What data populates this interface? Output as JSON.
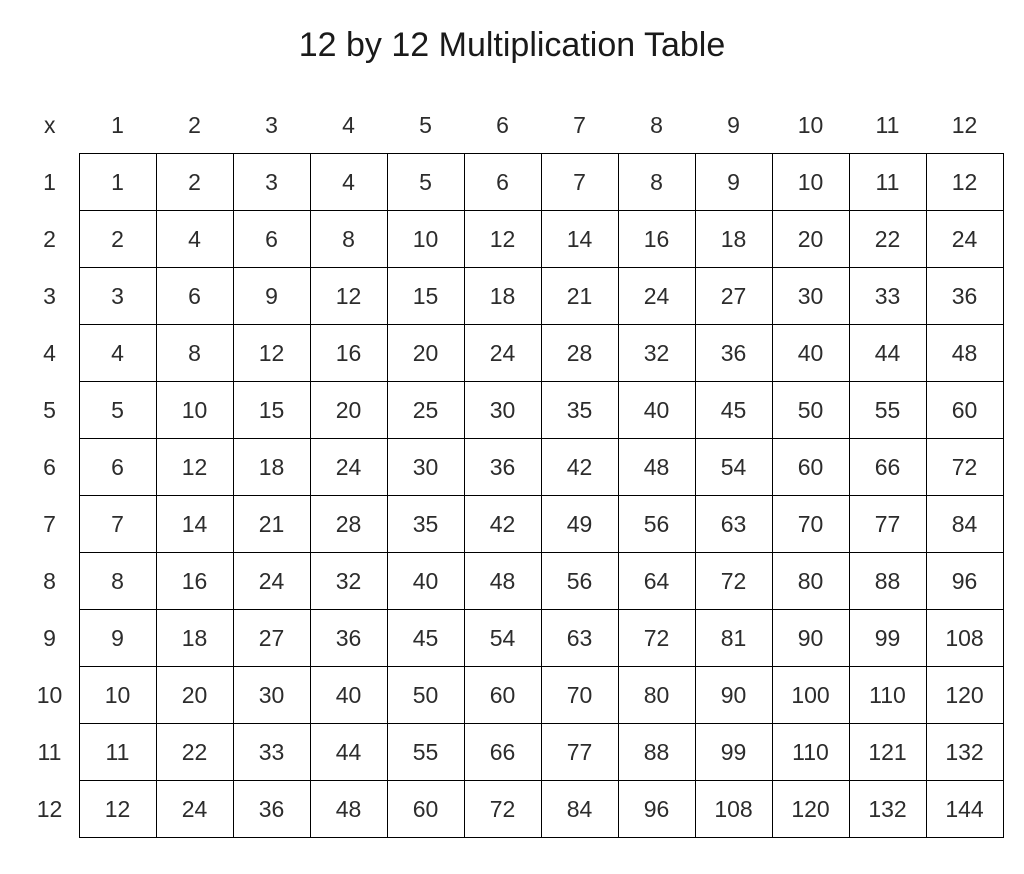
{
  "title": "12 by 12 Multiplication Table",
  "corner_label": "x",
  "size": 12,
  "chart_data": {
    "type": "table",
    "title": "12 by 12 Multiplication Table",
    "col_headers": [
      1,
      2,
      3,
      4,
      5,
      6,
      7,
      8,
      9,
      10,
      11,
      12
    ],
    "row_headers": [
      1,
      2,
      3,
      4,
      5,
      6,
      7,
      8,
      9,
      10,
      11,
      12
    ],
    "rows": [
      [
        1,
        2,
        3,
        4,
        5,
        6,
        7,
        8,
        9,
        10,
        11,
        12
      ],
      [
        2,
        4,
        6,
        8,
        10,
        12,
        14,
        16,
        18,
        20,
        22,
        24
      ],
      [
        3,
        6,
        9,
        12,
        15,
        18,
        21,
        24,
        27,
        30,
        33,
        36
      ],
      [
        4,
        8,
        12,
        16,
        20,
        24,
        28,
        32,
        36,
        40,
        44,
        48
      ],
      [
        5,
        10,
        15,
        20,
        25,
        30,
        35,
        40,
        45,
        50,
        55,
        60
      ],
      [
        6,
        12,
        18,
        24,
        30,
        36,
        42,
        48,
        54,
        60,
        66,
        72
      ],
      [
        7,
        14,
        21,
        28,
        35,
        42,
        49,
        56,
        63,
        70,
        77,
        84
      ],
      [
        8,
        16,
        24,
        32,
        40,
        48,
        56,
        64,
        72,
        80,
        88,
        96
      ],
      [
        9,
        18,
        27,
        36,
        45,
        54,
        63,
        72,
        81,
        90,
        99,
        108
      ],
      [
        10,
        20,
        30,
        40,
        50,
        60,
        70,
        80,
        90,
        100,
        110,
        120
      ],
      [
        11,
        22,
        33,
        44,
        55,
        66,
        77,
        88,
        99,
        110,
        121,
        132
      ],
      [
        12,
        24,
        36,
        48,
        60,
        72,
        84,
        96,
        108,
        120,
        132,
        144
      ]
    ]
  }
}
